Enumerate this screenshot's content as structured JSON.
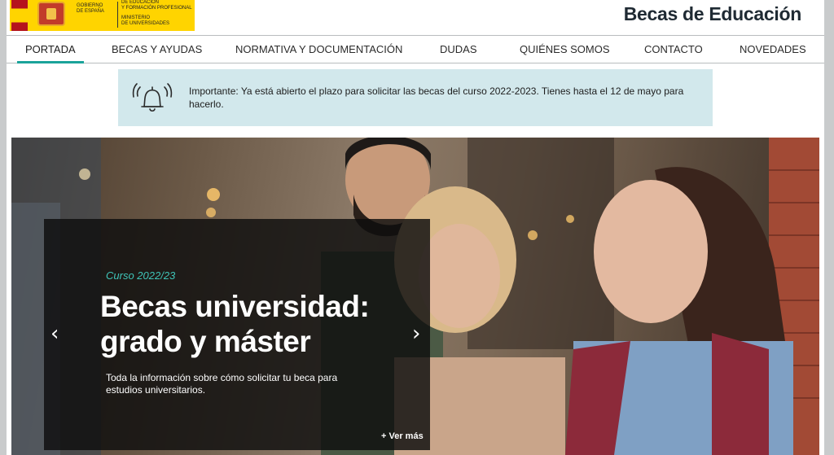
{
  "header": {
    "org_line1": [
      "Gobierno",
      "de España"
    ],
    "org_line2": [
      "de Educación",
      "y Formación Profesional"
    ],
    "org_line3": [
      "Ministerio",
      "de Universidades"
    ],
    "site_title": "Becas de Educación"
  },
  "nav": {
    "items": [
      {
        "label": "Portada",
        "active": true
      },
      {
        "label": "Becas y ayudas"
      },
      {
        "label": "Normativa y documentación"
      },
      {
        "label": "Dudas"
      },
      {
        "label": "Quiénes somos"
      },
      {
        "label": "Contacto"
      },
      {
        "label": "Novedades"
      }
    ]
  },
  "notice": {
    "icon": "bell-icon",
    "text": "Importante: Ya está abierto el plazo para solicitar las becas del curso 2022-2023. Tienes hasta el 12 de mayo para hacerlo."
  },
  "hero": {
    "kicker": "Curso 2022/23",
    "title_line1": "Becas universidad:",
    "title_line2": "grado y máster",
    "description": "Toda la información sobre cómo solicitar tu beca para estudios universitarios.",
    "more_label": "+ Ver más",
    "prev_icon": "chevron-left-icon",
    "next_icon": "chevron-right-icon"
  },
  "colors": {
    "accent": "#1aa39a",
    "kicker": "#3fc4b8",
    "notice_bg": "#d2e8ec",
    "logo_yellow": "#ffd400"
  }
}
